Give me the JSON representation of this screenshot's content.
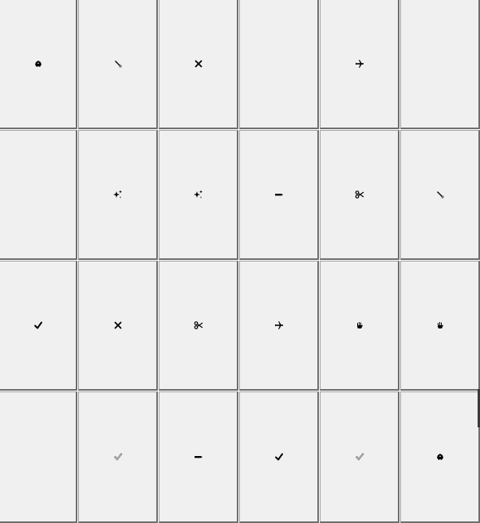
{
  "grid": {
    "rows": [
      [
        "bug-icon",
        "marker-icon",
        "close-x-icon",
        "",
        "airplane-icon",
        ""
      ],
      [
        "",
        "sparkles-icon",
        "sparkles-icon",
        "pencil-icon",
        "scissors-icon",
        "marker-icon"
      ],
      [
        "checkmark-icon",
        "close-x-icon",
        "scissors-icon",
        "airplane-icon",
        "hand-icon",
        "hand-icon"
      ],
      [
        "",
        "check-outline-icon",
        "pencil-icon",
        "checkmark-icon",
        "check-outline-icon",
        "bug-icon"
      ]
    ]
  },
  "colors": {
    "tile_background": "#f0f0f0",
    "tile_shadow": "#6e6e6e",
    "tile_highlight": "#a0a0a0",
    "icon_color": "#000000",
    "outline_icon_color": "#7a7a7a"
  }
}
